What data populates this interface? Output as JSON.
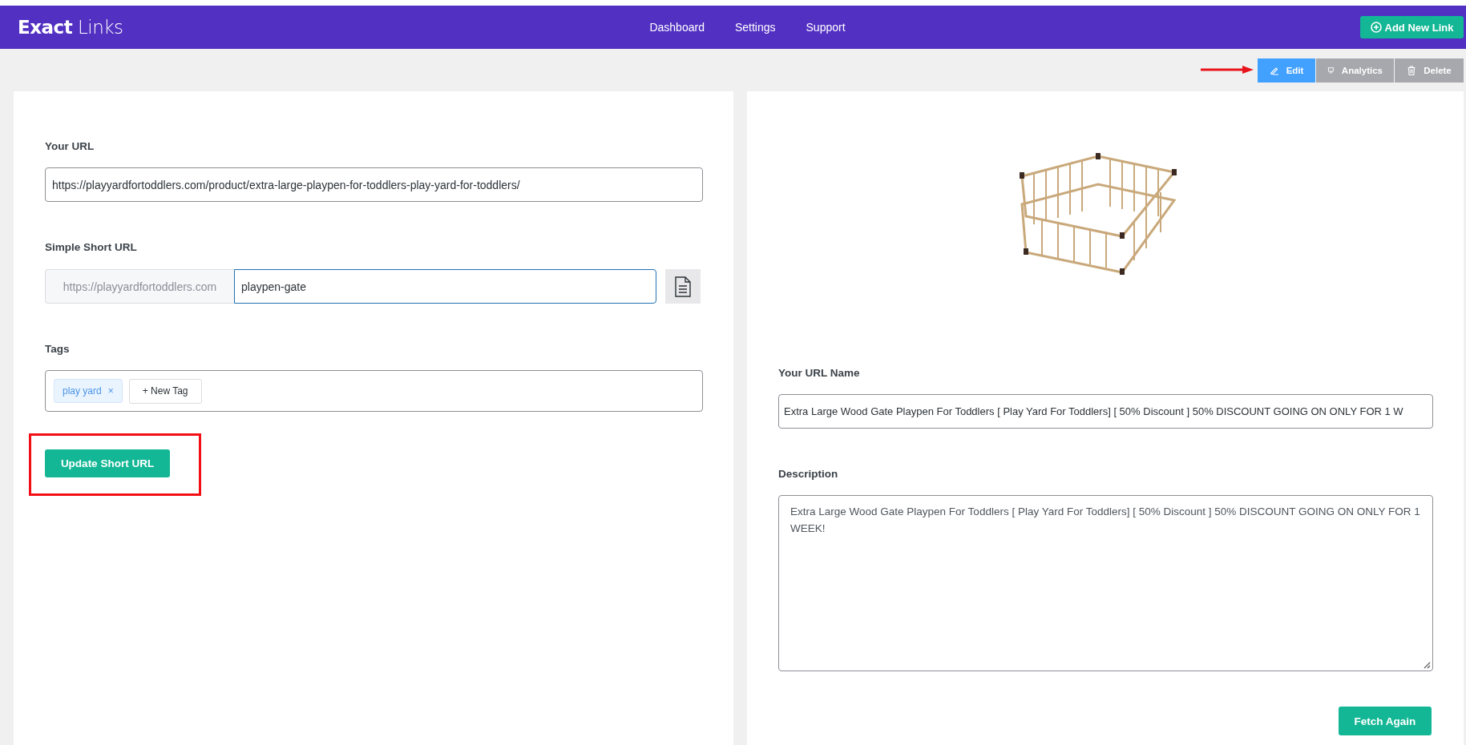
{
  "header": {
    "logo": "**Exact** Links",
    "nav": [
      "Dashboard",
      "Settings",
      "Support"
    ],
    "add_button": "Add New Link"
  },
  "actions": [
    {
      "kind": "edit",
      "label": "Edit",
      "selected": true
    },
    {
      "kind": "analytics",
      "label": "Analytics",
      "selected": false
    },
    {
      "kind": "delete",
      "label": "Delete",
      "selected": false
    }
  ],
  "link_form": {
    "url_label": "Your URL",
    "url_value": "https://playyardfortoddlers.com/product/extra-large-playpen-for-toddlers-play-yard-for-toddlers/",
    "short_label": "Simple Short URL",
    "short_prefix": "https://playyardfortoddlers.com",
    "short_value": "playpen-gate",
    "tags_label": "Tags",
    "tags": [
      {
        "label": "play yard",
        "remove": "×"
      }
    ],
    "new_tag": "+ New Tag",
    "submit": "Update Short URL"
  },
  "preview": {
    "name_label": "Your URL Name",
    "name_value": "Extra Large Wood Gate Playpen For Toddlers [ Play Yard For Toddlers] [ 50% Discount ] 50% DISCOUNT GOING ON ONLY FOR 1 W",
    "description_label": "Description",
    "description_value": "Extra Large Wood Gate Playpen For Toddlers [ Play Yard For Toddlers] [ 50% Discount ] 50% DISCOUNT GOING ON ONLY FOR 1 WEEK!",
    "fetch_button": "Fetch Again"
  }
}
